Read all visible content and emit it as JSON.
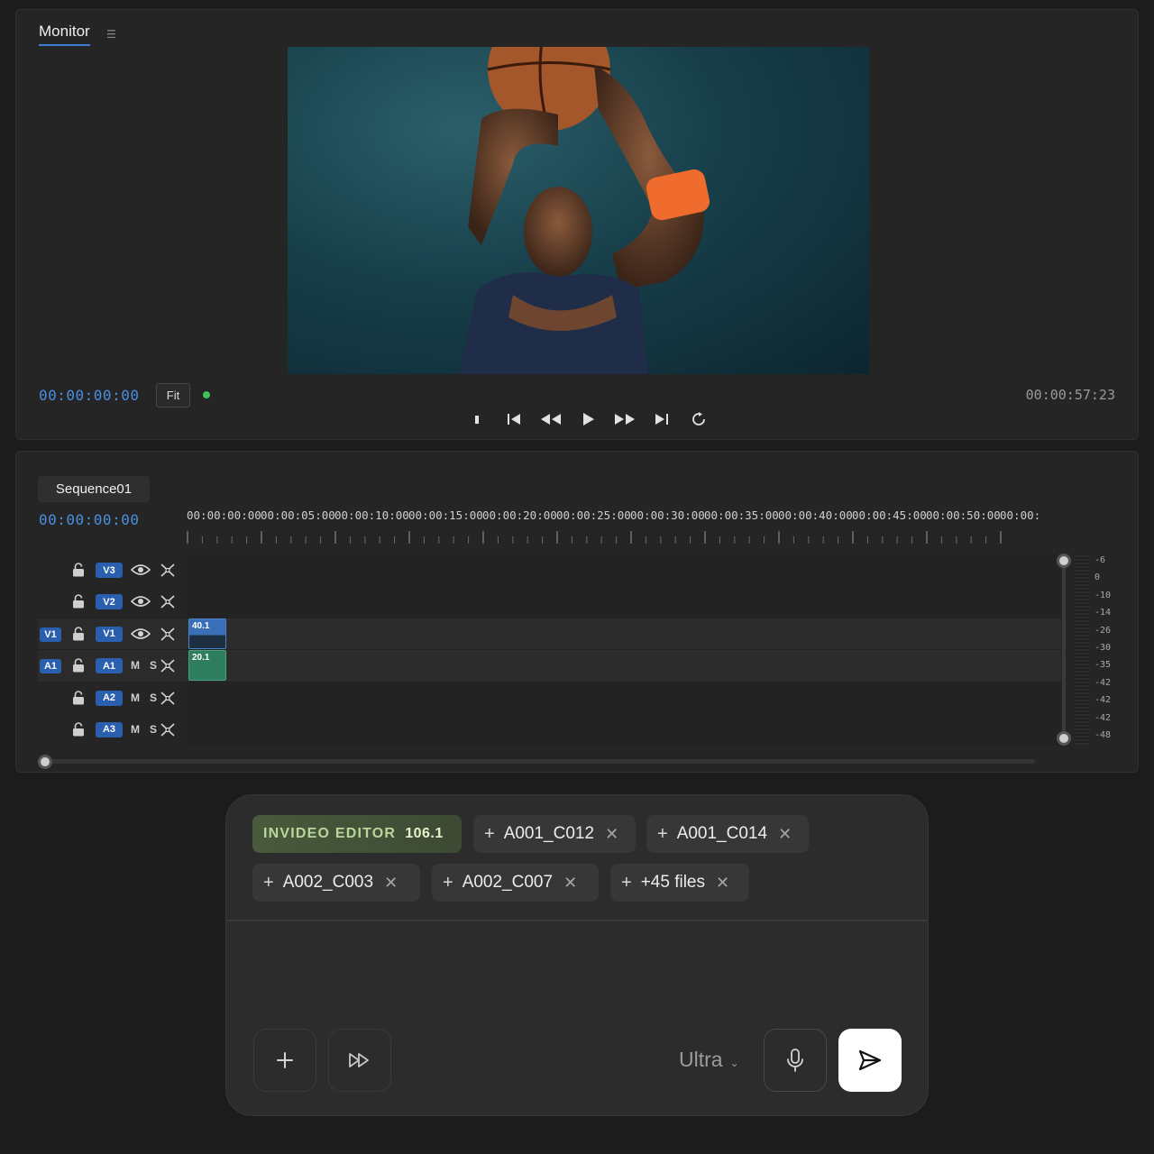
{
  "monitor": {
    "tab_label": "Monitor",
    "menu_icon": "hamburger-icon",
    "timecode_current": "00:00:00:00",
    "fit_label": "Fit",
    "timecode_duration": "00:00:57:23",
    "transport_icons": [
      "stop-icon",
      "go-to-start-icon",
      "rewind-icon",
      "play-icon",
      "fast-forward-icon",
      "go-to-end-icon",
      "loop-icon"
    ]
  },
  "sequence": {
    "tab_label": "Sequence01",
    "timecode": "00:00:00:00",
    "ruler": [
      "00:00:00:00",
      "00:00:05:00",
      "00:00:10:00",
      "00:00:15:00",
      "00:00:20:00",
      "00:00:25:00",
      "00:00:30:00",
      "00:00:35:00",
      "00:00:40:00",
      "00:00:45:00",
      "00:00:50:00",
      "00:00:"
    ],
    "tracks": [
      {
        "name": "V3",
        "source": "",
        "kind": "video"
      },
      {
        "name": "V2",
        "source": "",
        "kind": "video"
      },
      {
        "name": "V1",
        "source": "V1",
        "kind": "video",
        "clip": "40.1"
      },
      {
        "name": "A1",
        "source": "A1",
        "kind": "audio",
        "clip": "20.1",
        "mute": "M",
        "solo": "S"
      },
      {
        "name": "A2",
        "source": "",
        "kind": "audio",
        "mute": "M",
        "solo": "S"
      },
      {
        "name": "A3",
        "source": "",
        "kind": "audio",
        "mute": "M",
        "solo": "S"
      }
    ],
    "meter_scale": [
      "-6",
      "0",
      "-10",
      "-14",
      "-26",
      "-30",
      "-35",
      "-42",
      "-42",
      "-42",
      "-48"
    ],
    "accent_color": "#2a5fb0"
  },
  "prompt": {
    "brand_label": "INVIDEO EDITOR",
    "brand_version": "106.1",
    "chips": [
      "A001_C012",
      "A001_C014",
      "A002_C003",
      "A002_C007",
      "+45 files"
    ],
    "model_label": "Ultra",
    "icons": [
      "add-icon",
      "fast-forward-icon",
      "microphone-icon",
      "send-icon"
    ]
  }
}
